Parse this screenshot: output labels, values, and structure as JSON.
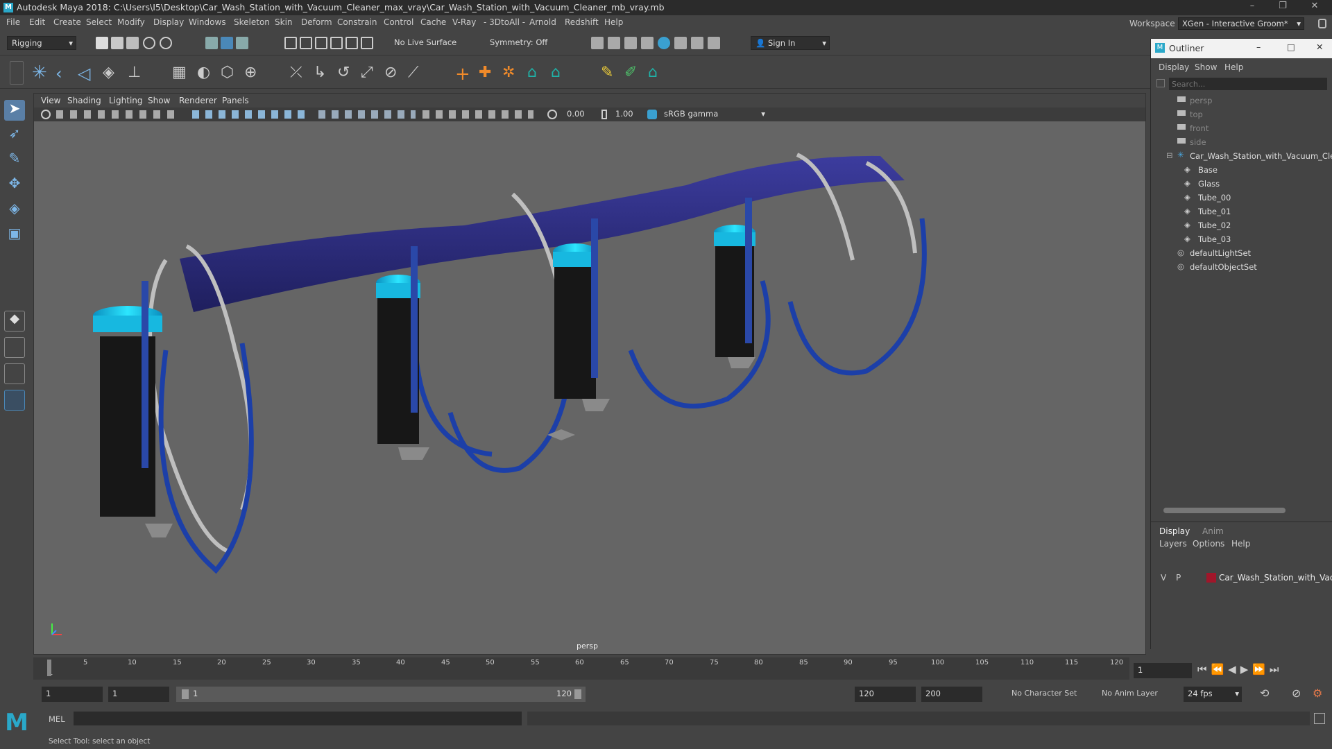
{
  "window": {
    "title": "Autodesk Maya 2018: C:\\Users\\I5\\Desktop\\Car_Wash_Station_with_Vacuum_Cleaner_max_vray\\Car_Wash_Station_with_Vacuum_Cleaner_mb_vray.mb",
    "minimize": "–",
    "maximize": "❐",
    "close": "✕"
  },
  "menu": [
    "File",
    "Edit",
    "Create",
    "Select",
    "Modify",
    "Display",
    "Windows",
    "Skeleton",
    "Skin",
    "Deform",
    "Constrain",
    "Control",
    "Cache",
    "V-Ray",
    "- 3DtoAll -",
    "Arnold",
    "Redshift",
    "Help"
  ],
  "workspace": {
    "label": "Workspace :",
    "value": "XGen - Interactive Groom*"
  },
  "statusline": {
    "mode": "Rigging",
    "live_surface": "No Live Surface",
    "symmetry": "Symmetry: Off",
    "sign_in": "Sign In"
  },
  "viewport": {
    "menus": [
      "View",
      "Shading",
      "Lighting",
      "Show",
      "Renderer",
      "Panels"
    ],
    "exposure": "0.00",
    "gamma": "1.00",
    "color_space": "sRGB gamma",
    "camera": "persp"
  },
  "outliner": {
    "title": "Outliner",
    "menus": [
      "Display",
      "Show",
      "Help"
    ],
    "search_placeholder": "Search...",
    "cameras": [
      "persp",
      "top",
      "front",
      "side"
    ],
    "group": "Car_Wash_Station_with_Vacuum_Clea",
    "children": [
      "Base",
      "Glass",
      "Tube_00",
      "Tube_01",
      "Tube_02",
      "Tube_03"
    ],
    "sets": [
      "defaultLightSet",
      "defaultObjectSet"
    ]
  },
  "layers": {
    "tabs": [
      "Display",
      "Anim"
    ],
    "menus": [
      "Layers",
      "Options",
      "Help"
    ],
    "row": {
      "v": "V",
      "p": "P",
      "name": "Car_Wash_Station_with_Vacuu",
      "color": "#a0162a"
    }
  },
  "timeline": {
    "ticks": [
      "5",
      "10",
      "15",
      "20",
      "25",
      "30",
      "35",
      "40",
      "45",
      "50",
      "55",
      "60",
      "65",
      "70",
      "75",
      "80",
      "85",
      "90",
      "95",
      "100",
      "105",
      "110",
      "115",
      "120"
    ],
    "first": "1",
    "current": "1"
  },
  "range": {
    "start": "1",
    "anim_start": "1",
    "slider_start": "1",
    "slider_end": "120",
    "end": "120",
    "anim_end": "200",
    "character_set": "No Character Set",
    "anim_layer": "No Anim Layer",
    "fps": "24 fps"
  },
  "cmd": {
    "label": "MEL"
  },
  "help_line": "Select Tool: select an object"
}
